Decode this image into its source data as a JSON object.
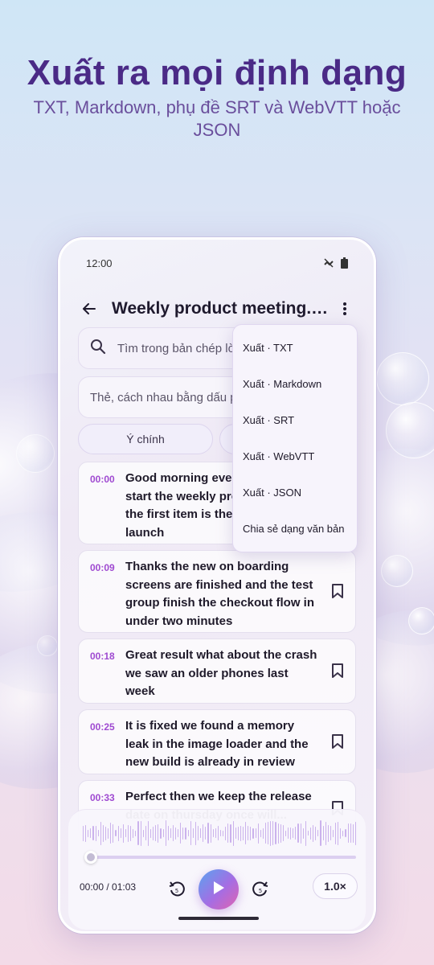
{
  "promo": {
    "headline": "Xuất ra mọi định dạng",
    "subline": "TXT, Markdown, phụ đề SRT và WebVTT hoặc JSON"
  },
  "status_bar": {
    "time": "12:00",
    "icons": [
      "sync-off-icon",
      "battery-icon"
    ]
  },
  "app_bar": {
    "title": "Weekly product meeting.m...",
    "back_icon": "arrow-back-icon",
    "more_icon": "more-vert-icon"
  },
  "search": {
    "placeholder": "Tìm trong bản chép lời"
  },
  "tags": {
    "placeholder": "Thẻ, cách nhau bằng dấu phẩy"
  },
  "chips": [
    {
      "label": "Ý chính"
    },
    {
      "label": ""
    }
  ],
  "segments": [
    {
      "time": "00:00",
      "text": "Good morning everyone let's start the weekly product meeting the first item is the mobile app launch",
      "visible_text": "Good morning eve start the weekly pr first item is the mo launch"
    },
    {
      "time": "00:09",
      "text": "Thanks the new on boarding screens are finished and the test group finish the checkout flow in under two minutes"
    },
    {
      "time": "00:18",
      "text": "Great result what about the crash we saw an older phones last week"
    },
    {
      "time": "00:25",
      "text": "It is fixed we found a memory leak in the image loader and the new build is already in review"
    },
    {
      "time": "00:33",
      "text": "Perfect then we keep the release date on thursday once will..."
    }
  ],
  "export_menu": {
    "items": [
      {
        "label": "Xuất · TXT"
      },
      {
        "label": "Xuất · Markdown"
      },
      {
        "label": "Xuất · SRT"
      },
      {
        "label": "Xuất · WebVTT"
      },
      {
        "label": "Xuất · JSON"
      },
      {
        "label": "Chia sẻ dạng văn bản"
      }
    ]
  },
  "player": {
    "time_display": "00:00 / 01:03",
    "progress": 0,
    "speed": "1.0×",
    "rewind_icon": "replay-5-icon",
    "forward_icon": "forward-5-icon",
    "play_icon": "play-icon"
  },
  "colors": {
    "accent": "#9f4ad1",
    "headline": "#4a2a86",
    "play_gradient": [
      "#5aa3f0",
      "#a56de3",
      "#e064b0"
    ]
  }
}
